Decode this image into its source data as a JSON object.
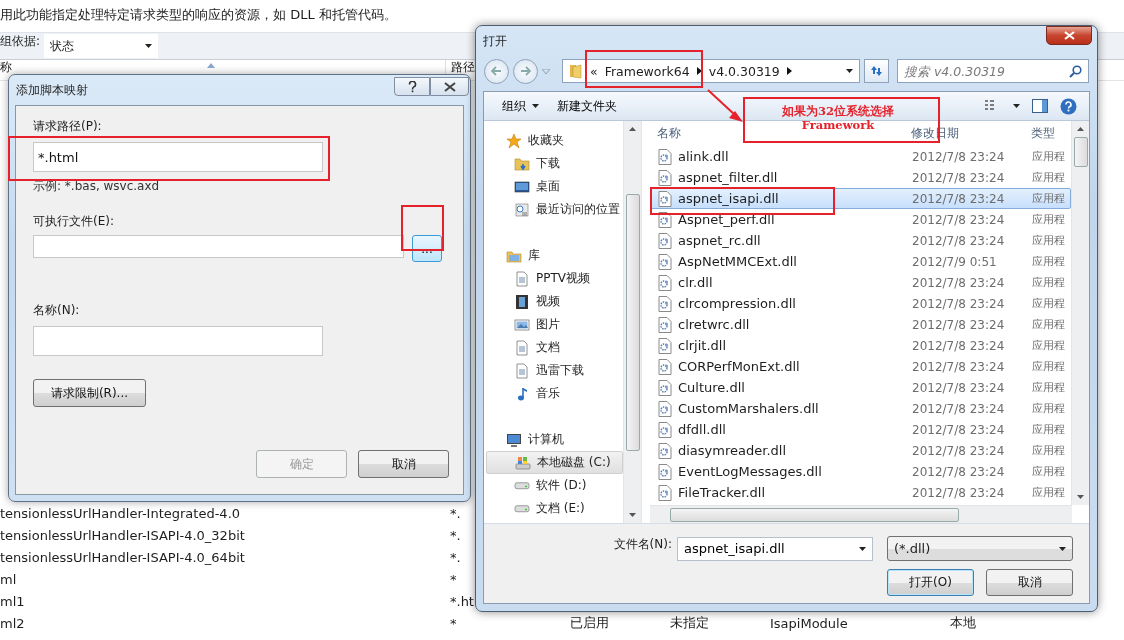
{
  "background": {
    "description": "用此功能指定处理特定请求类型的响应的资源，如 DLL 和托管代码。",
    "group_by": {
      "label": "组依据:",
      "value": "状态"
    },
    "columns": [
      "称",
      "路径"
    ],
    "rows": [
      {
        "cells": [
          "tensionlessUrlHandler-Integrated-4.0",
          "*."
        ]
      },
      {
        "cells": [
          "tensionlessUrlHandler-ISAPI-4.0_32bit",
          "*."
        ]
      },
      {
        "cells": [
          "tensionlessUrlHandler-ISAPI-4.0_64bit",
          "*."
        ]
      },
      {
        "cells": [
          "ml",
          "*"
        ]
      },
      {
        "cells": [
          "ml1",
          "*.ht"
        ]
      },
      {
        "cells": [
          "ml2",
          "*",
          "已启用",
          "未指定",
          "IsapiModule",
          "本地"
        ]
      }
    ]
  },
  "script_dialog": {
    "title": "添加脚本映射",
    "path": {
      "label": "请求路径(P):",
      "value": "*.html",
      "hint": "示例: *.bas, wsvc.axd"
    },
    "executable": {
      "label": "可执行文件(E):",
      "browse": "..."
    },
    "name": {
      "label": "名称(N):"
    },
    "limits_button": "请求限制(R)...",
    "buttons": [
      {
        "label": "确定",
        "disabled": true
      },
      {
        "label": "取消",
        "disabled": false
      }
    ]
  },
  "open_dialog": {
    "title": "打开",
    "overflow": "«",
    "breadcrumb": [
      "Framework64",
      "v4.0.30319"
    ],
    "search": {
      "placeholder": "搜索 v4.0.30319"
    },
    "toolbar": {
      "organize": "组织",
      "new_folder": "新建文件夹"
    },
    "nav": [
      {
        "label": "收藏夹",
        "kind": "star",
        "selected": false,
        "children": [
          {
            "label": "下载",
            "kind": "download",
            "selected": false
          },
          {
            "label": "桌面",
            "kind": "desktop",
            "selected": false
          },
          {
            "label": "最近访问的位置",
            "kind": "recent",
            "selected": false
          }
        ]
      },
      {
        "label": "库",
        "kind": "library",
        "selected": false,
        "children": [
          {
            "label": "PPTV视频",
            "kind": "doc",
            "selected": false
          },
          {
            "label": "视频",
            "kind": "film",
            "selected": false
          },
          {
            "label": "图片",
            "kind": "picture",
            "selected": false
          },
          {
            "label": "文档",
            "kind": "doc",
            "selected": false
          },
          {
            "label": "迅雷下载",
            "kind": "doc",
            "selected": false
          },
          {
            "label": "音乐",
            "kind": "music",
            "selected": false
          }
        ]
      },
      {
        "label": "计算机",
        "kind": "computer",
        "selected": false,
        "children": [
          {
            "label": "本地磁盘 (C:)",
            "kind": "system_disk",
            "selected": true
          },
          {
            "label": "软件 (D:)",
            "kind": "drive",
            "selected": false
          },
          {
            "label": "文档 (E:)",
            "kind": "drive",
            "selected": false
          }
        ]
      }
    ],
    "columns": [
      "名称",
      "修改日期",
      "类型"
    ],
    "files": [
      {
        "name": "alink.dll",
        "date": "2012/7/8 23:24",
        "type": "应用程",
        "selected": false
      },
      {
        "name": "aspnet_filter.dll",
        "date": "2012/7/8 23:24",
        "type": "应用程",
        "selected": false
      },
      {
        "name": "aspnet_isapi.dll",
        "date": "2012/7/8 23:24",
        "type": "应用程",
        "selected": true
      },
      {
        "name": "Aspnet_perf.dll",
        "date": "2012/7/8 23:24",
        "type": "应用程",
        "selected": false
      },
      {
        "name": "aspnet_rc.dll",
        "date": "2012/7/8 23:24",
        "type": "应用程",
        "selected": false
      },
      {
        "name": "AspNetMMCExt.dll",
        "date": "2012/7/9 0:51",
        "type": "应用程",
        "selected": false
      },
      {
        "name": "clr.dll",
        "date": "2012/7/8 23:24",
        "type": "应用程",
        "selected": false
      },
      {
        "name": "clrcompression.dll",
        "date": "2012/7/8 23:24",
        "type": "应用程",
        "selected": false
      },
      {
        "name": "clretwrc.dll",
        "date": "2012/7/8 23:24",
        "type": "应用程",
        "selected": false
      },
      {
        "name": "clrjit.dll",
        "date": "2012/7/8 23:24",
        "type": "应用程",
        "selected": false
      },
      {
        "name": "CORPerfMonExt.dll",
        "date": "2012/7/8 23:24",
        "type": "应用程",
        "selected": false
      },
      {
        "name": "Culture.dll",
        "date": "2012/7/8 23:24",
        "type": "应用程",
        "selected": false
      },
      {
        "name": "CustomMarshalers.dll",
        "date": "2012/7/8 23:24",
        "type": "应用程",
        "selected": false
      },
      {
        "name": "dfdll.dll",
        "date": "2012/7/8 23:24",
        "type": "应用程",
        "selected": false
      },
      {
        "name": "diasymreader.dll",
        "date": "2012/7/8 23:24",
        "type": "应用程",
        "selected": false
      },
      {
        "name": "EventLogMessages.dll",
        "date": "2012/7/8 23:24",
        "type": "应用程",
        "selected": false
      },
      {
        "name": "FileTracker.dll",
        "date": "2012/7/8 23:24",
        "type": "应用程",
        "selected": false
      }
    ],
    "file_name": {
      "label": "文件名(N):",
      "value": "aspnet_isapi.dll"
    },
    "filter": "(*.dll)",
    "buttons": [
      "打开(O)",
      "取消"
    ]
  },
  "annotation": {
    "note": "如果为32位系统选择\nFramework"
  }
}
